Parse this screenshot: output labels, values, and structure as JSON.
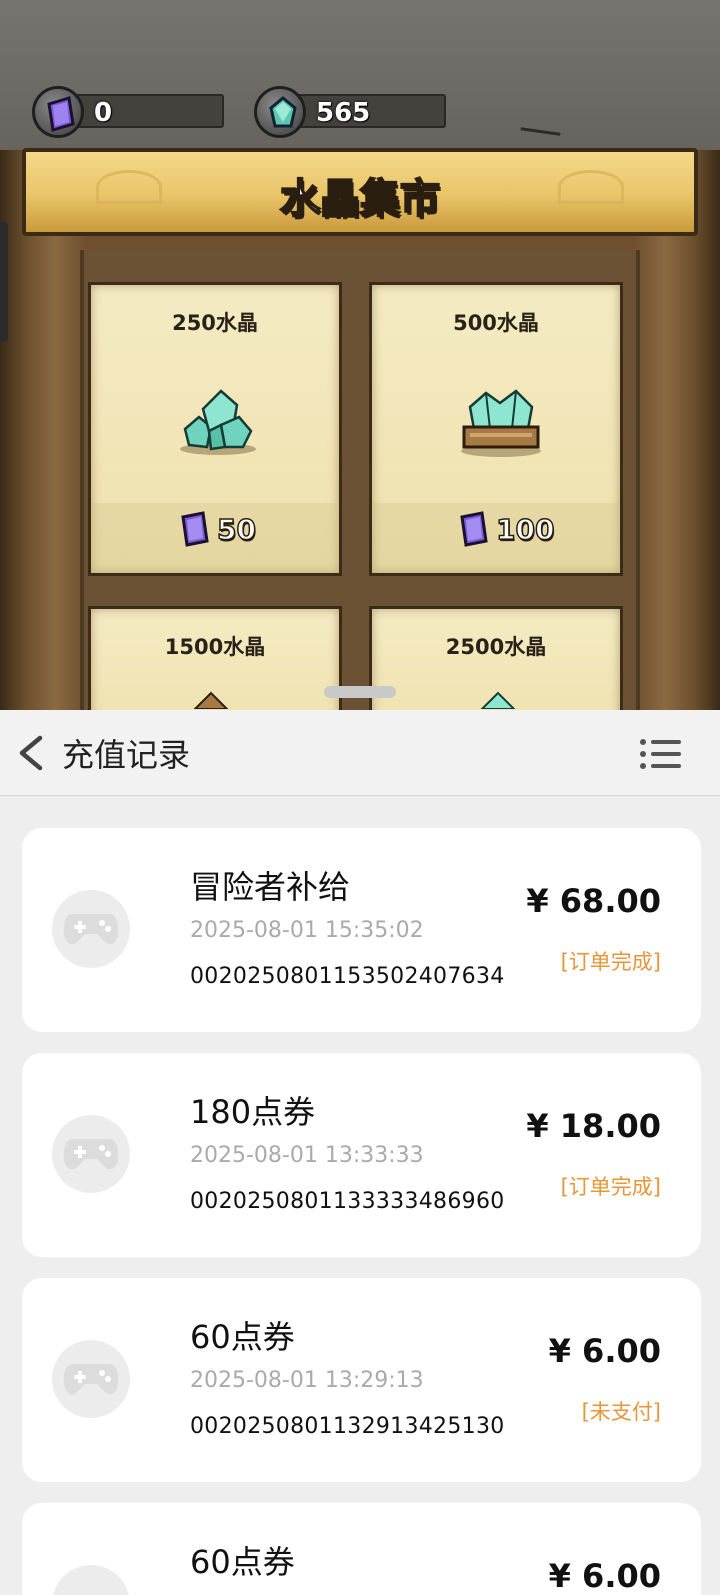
{
  "game": {
    "currencies": [
      {
        "icon": "purple-crystal-coin-icon",
        "value": "0"
      },
      {
        "icon": "green-crystal-coin-icon",
        "value": "565"
      }
    ],
    "banner_title": "水晶集市",
    "products": [
      {
        "name": "250水晶",
        "price": "50",
        "image": "green-crystal-pile-icon"
      },
      {
        "name": "500水晶",
        "price": "100",
        "image": "crystal-crate-icon"
      },
      {
        "name": "1500水晶",
        "price": "",
        "image": "crystal-chest-icon"
      },
      {
        "name": "2500水晶",
        "price": "",
        "image": "crystal-chest-icon"
      }
    ]
  },
  "panel": {
    "title": "充值记录",
    "records": [
      {
        "name": "冒险者补给",
        "time": "2025-08-01 15:35:02",
        "order": "0020250801153502407634",
        "amount": "¥ 68.00",
        "status": "[订单完成]"
      },
      {
        "name": "180点券",
        "time": "2025-08-01 13:33:33",
        "order": "0020250801133333486960",
        "amount": "¥ 18.00",
        "status": "[订单完成]"
      },
      {
        "name": "60点券",
        "time": "2025-08-01 13:29:13",
        "order": "0020250801132913425130",
        "amount": "¥ 6.00",
        "status": "[未支付]"
      },
      {
        "name": "60点券",
        "time": "",
        "order": "",
        "amount": "¥ 6.00",
        "status": ""
      }
    ]
  },
  "colors": {
    "status_orange": "#e8963a",
    "banner_gold": "#e9c468",
    "card_parchment": "#f4ebc4"
  }
}
